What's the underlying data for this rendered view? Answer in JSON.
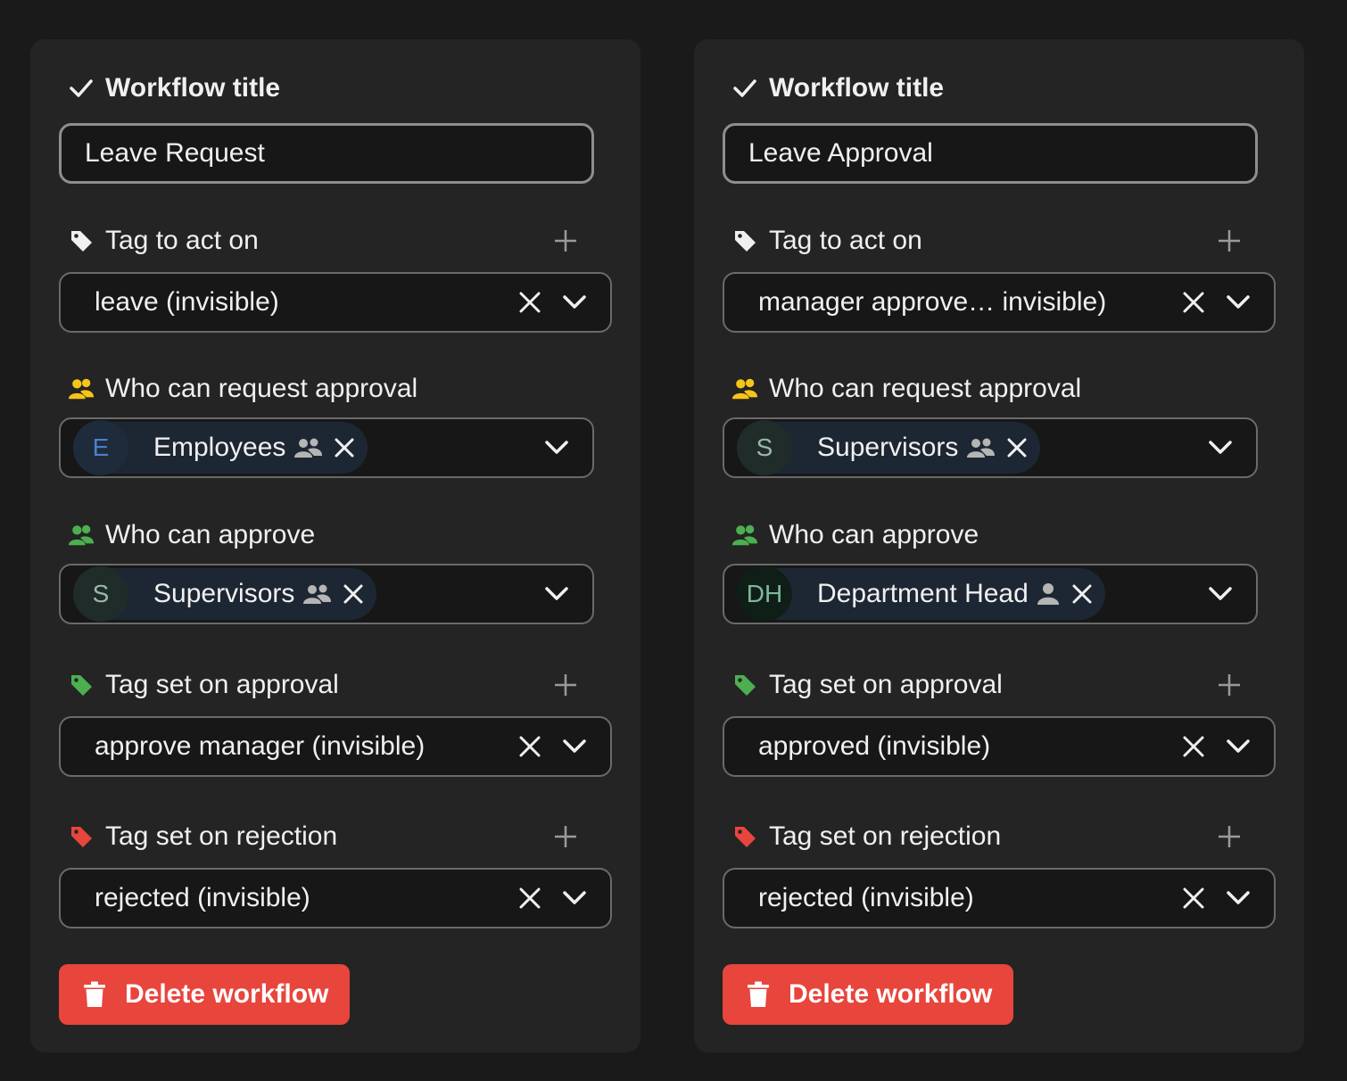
{
  "colors": {
    "page_bg": "#1a1a1a",
    "card_bg": "#242424",
    "danger": "#e8453c",
    "group_icon_yellow": "#f5c518",
    "group_icon_green": "#4caf50",
    "tag_green": "#4caf50",
    "tag_red": "#e8453c"
  },
  "workflows": [
    {
      "title_label": "Workflow title",
      "title_value": "Leave Request",
      "tag_act_label": "Tag to act on",
      "tag_act_value": "leave (invisible)",
      "request_label": "Who can request approval",
      "request_chip": {
        "initials": "E",
        "name": "Employees",
        "icon": "users-icon"
      },
      "approve_label": "Who can approve",
      "approve_chip": {
        "initials": "S",
        "name": "Supervisors",
        "icon": "users-icon"
      },
      "approval_tag_label": "Tag set on approval",
      "approval_tag_value": "approve manager (invisible)",
      "rejection_tag_label": "Tag set on rejection",
      "rejection_tag_value": "rejected (invisible)",
      "delete_label": "Delete workflow"
    },
    {
      "title_label": "Workflow title",
      "title_value": "Leave Approval",
      "tag_act_label": "Tag to act on",
      "tag_act_value": "manager approve…  invisible)",
      "request_label": "Who can request approval",
      "request_chip": {
        "initials": "S",
        "name": "Supervisors",
        "icon": "users-icon"
      },
      "approve_label": "Who can approve",
      "approve_chip": {
        "initials": "DH",
        "name": "Department Head",
        "icon": "user-icon"
      },
      "approval_tag_label": "Tag set on approval",
      "approval_tag_value": "approved (invisible)",
      "rejection_tag_label": "Tag set on rejection",
      "rejection_tag_value": "rejected (invisible)",
      "delete_label": "Delete workflow"
    }
  ]
}
